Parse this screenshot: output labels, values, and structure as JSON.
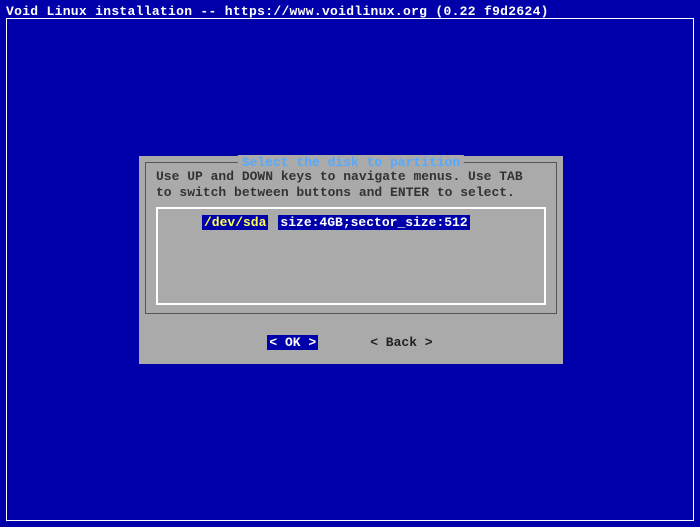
{
  "title": "Void Linux installation -- https://www.voidlinux.org (0.22 f9d2624)",
  "dialog": {
    "title": "Select the disk to partition",
    "instructions": "Use UP and DOWN keys to navigate menus. Use TAB to switch between buttons and ENTER to select.",
    "items": [
      {
        "device": "/dev/sda",
        "info": "size:4GB;sector_size:512"
      }
    ],
    "buttons": {
      "ok": "<  OK  >",
      "back": "< Back >"
    }
  }
}
